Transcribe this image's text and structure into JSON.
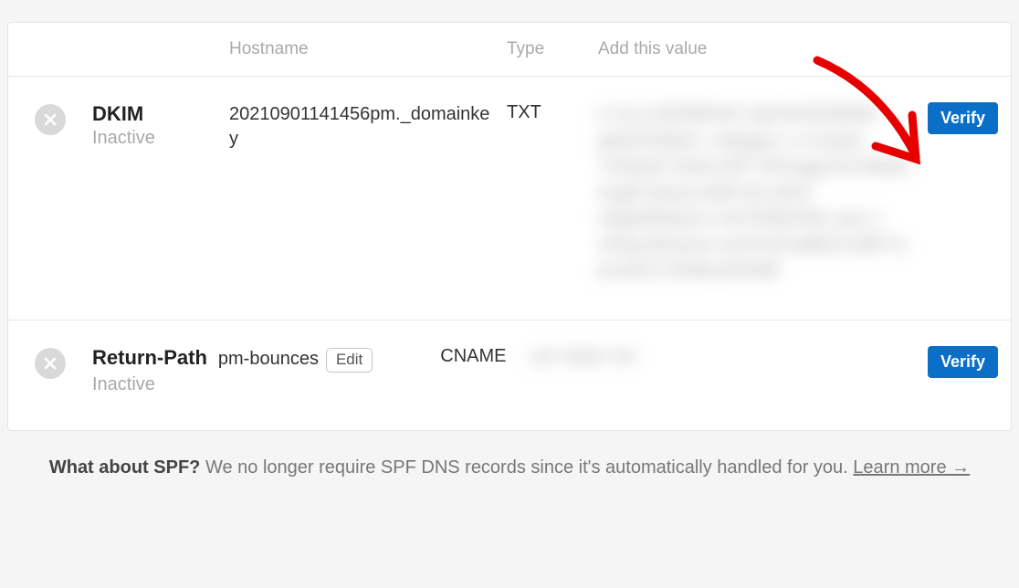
{
  "headers": {
    "hostname": "Hostname",
    "type": "Type",
    "value": "Add this value"
  },
  "rows": [
    {
      "name": "DKIM",
      "status": "Inactive",
      "hostname": "20210901141456pm._domainkey",
      "type": "TXT",
      "value_obfuscated": true,
      "verify_label": "Verify"
    },
    {
      "name": "Return-Path",
      "status": "Inactive",
      "hostname": "pm-bounces",
      "edit_label": "Edit",
      "type": "CNAME",
      "value_obfuscated": true,
      "verify_label": "Verify"
    }
  ],
  "footer": {
    "lead": "What about SPF?",
    "text": "We no longer require SPF DNS records since it's automatically handled for you.",
    "link": "Learn more →"
  }
}
